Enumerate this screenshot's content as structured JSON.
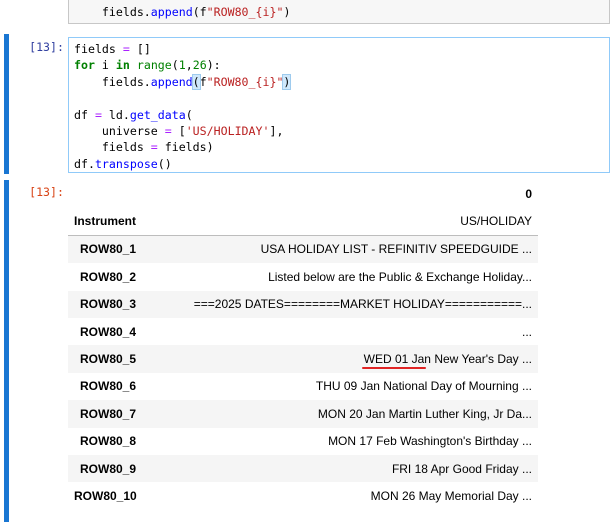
{
  "prev_cell": {
    "line": "    fields.append(f\"ROW80_{i}\")"
  },
  "code_cell": {
    "prompt": "[13]:",
    "lines": [
      "fields = []",
      "for i in range(1,26):",
      "    fields.append(f\"ROW80_{i}\")",
      "",
      "df = ld.get_data(",
      "    universe = ['US/HOLIDAY'],",
      "    fields = fields)",
      "df.transpose()"
    ]
  },
  "output_cell": {
    "prompt": "[13]:",
    "column_header": "0",
    "index_name": "Instrument",
    "index_value": "US/HOLIDAY",
    "rows": [
      {
        "label": "ROW80_1",
        "value": "USA HOLIDAY LIST - REFINITIV SPEEDGUIDE ..."
      },
      {
        "label": "ROW80_2",
        "value": "Listed below are the Public & Exchange Holiday..."
      },
      {
        "label": "ROW80_3",
        "value": "===2025 DATES========MARKET HOLIDAY===========..."
      },
      {
        "label": "ROW80_4",
        "value": "..."
      },
      {
        "label": "ROW80_5",
        "value": "WED 01 Jan New Year's Day ..."
      },
      {
        "label": "ROW80_6",
        "value": "THU 09 Jan National Day of Mourning ..."
      },
      {
        "label": "ROW80_7",
        "value": "MON 20 Jan Martin Luther King, Jr Da..."
      },
      {
        "label": "ROW80_8",
        "value": "MON 17 Feb Washington's Birthday ..."
      },
      {
        "label": "ROW80_9",
        "value": "FRI 18 Apr Good Friday ..."
      },
      {
        "label": "ROW80_10",
        "value": "MON 26 May Memorial Day ..."
      }
    ],
    "annotation_color": "#e02424"
  }
}
